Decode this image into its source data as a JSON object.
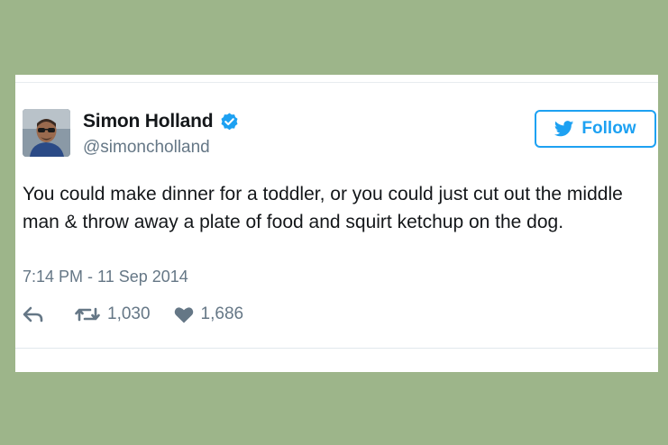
{
  "tweet": {
    "display_name": "Simon Holland",
    "handle": "@simoncholland",
    "follow_label": "Follow",
    "text": "You could make dinner for a toddler, or you could just cut out the middle man & throw away a plate of food and squirt ketchup on the dog.",
    "timestamp": "7:14 PM - 11 Sep 2014",
    "retweet_count": "1,030",
    "like_count": "1,686"
  },
  "icons": {
    "verified": "verified-badge-icon",
    "bird": "twitter-bird-icon",
    "reply": "reply-arrow-icon",
    "retweet": "retweet-icon",
    "like": "heart-icon"
  },
  "colors": {
    "background": "#9db58a",
    "accent": "#1da1f2",
    "text": "#14171a",
    "secondary_text": "#657786"
  }
}
